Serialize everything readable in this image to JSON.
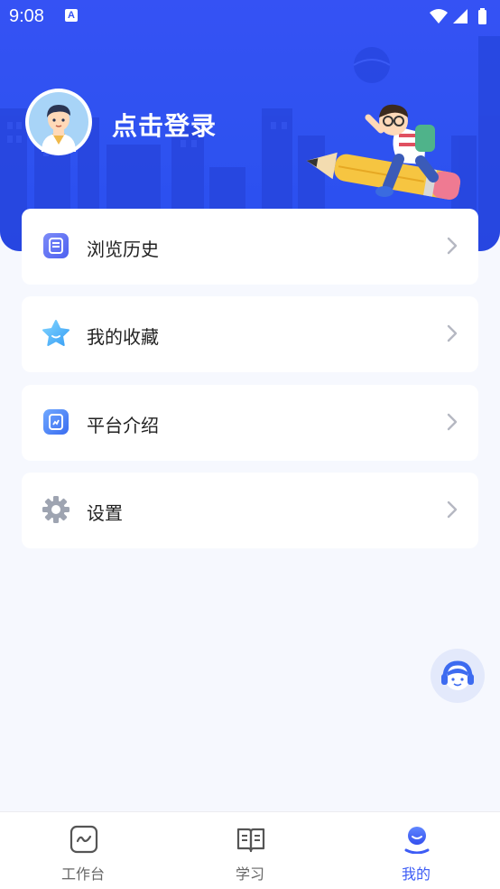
{
  "status_bar": {
    "time": "9:08",
    "notification_icon": "A"
  },
  "header": {
    "login_text": "点击登录"
  },
  "menu": [
    {
      "label": "浏览历史",
      "icon": "history-icon"
    },
    {
      "label": "我的收藏",
      "icon": "star-icon"
    },
    {
      "label": "平台介绍",
      "icon": "info-doc-icon"
    },
    {
      "label": "设置",
      "icon": "gear-icon"
    }
  ],
  "tabbar": [
    {
      "label": "工作台",
      "icon": "workbench-icon",
      "active": false
    },
    {
      "label": "学习",
      "icon": "book-icon",
      "active": false
    },
    {
      "label": "我的",
      "icon": "profile-icon",
      "active": true
    }
  ],
  "colors": {
    "primary": "#3552f4",
    "active_tab": "#3d5cf5",
    "background": "#f6f8fe"
  }
}
